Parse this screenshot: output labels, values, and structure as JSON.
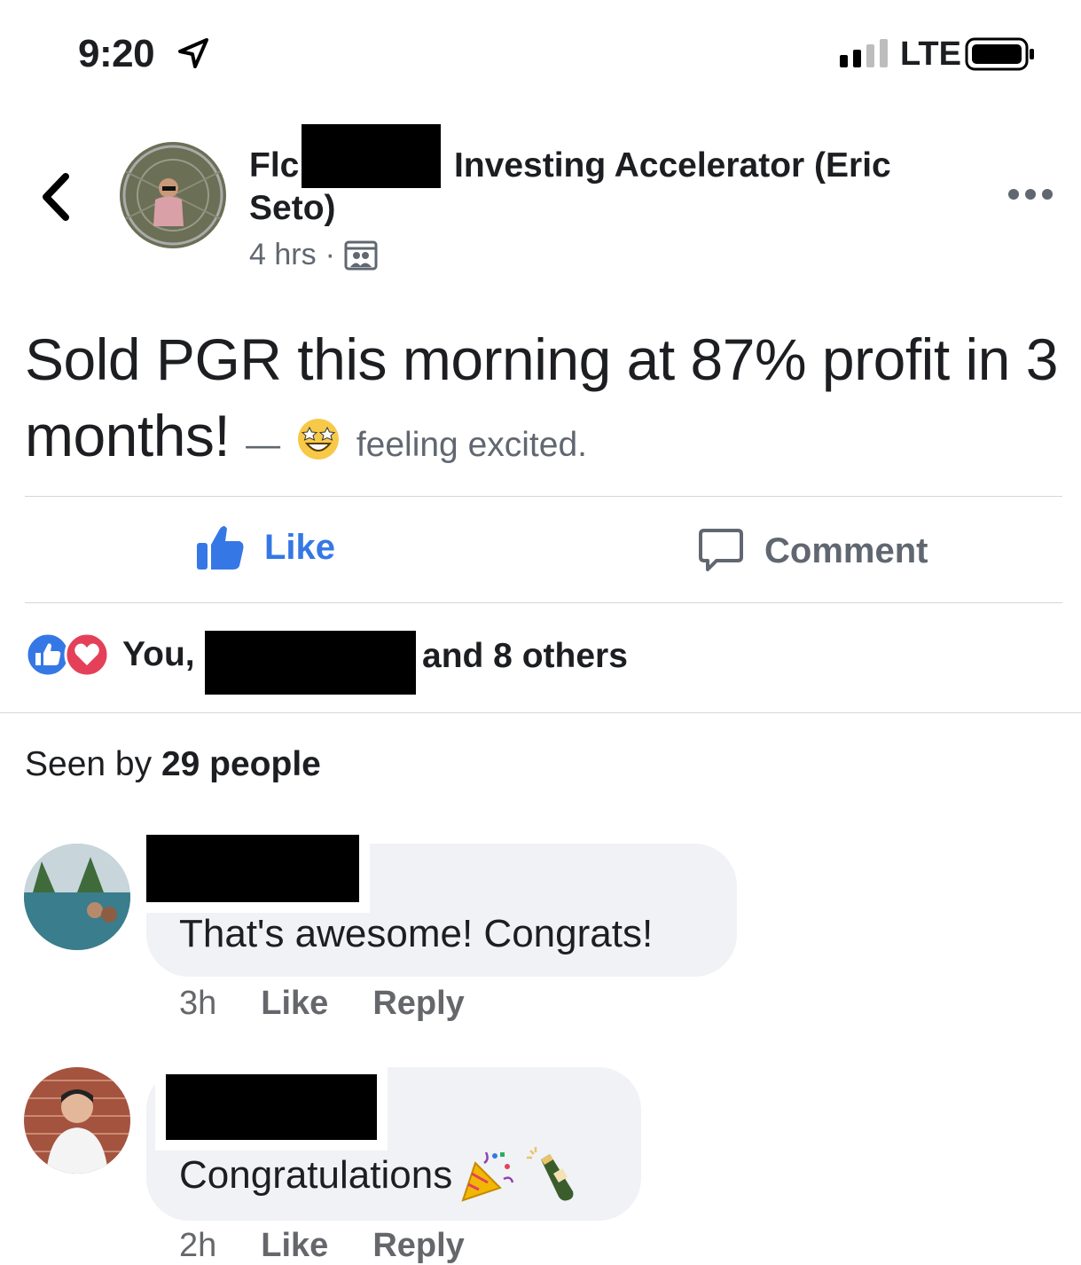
{
  "status_bar": {
    "time": "9:20",
    "network": "LTE"
  },
  "post": {
    "group_title_part1": "Flc",
    "group_title_part2": "Investing Accelerator (Eric",
    "group_title_line2": "Seto)",
    "time_ago": "4 hrs",
    "dot": "·",
    "text": "Sold PGR this morning at 87% profit in 3 months!",
    "feeling_dash": "—",
    "feeling_text": "feeling excited."
  },
  "actions": {
    "like_label": "Like",
    "comment_label": "Comment"
  },
  "reactions": {
    "you_label": "You,",
    "others_label": "and 8 others"
  },
  "seen": {
    "prefix": "Seen by",
    "count": "29 people"
  },
  "comments": [
    {
      "text": "That's awesome! Congrats!",
      "time": "3h",
      "like": "Like",
      "reply": "Reply"
    },
    {
      "text": "Congratulations",
      "time": "2h",
      "like": "Like",
      "reply": "Reply"
    }
  ],
  "colors": {
    "like_blue": "#3578e5",
    "love_red": "#e4405a",
    "bubble_gray": "#f0f2f5",
    "secondary_text": "#606770"
  },
  "icons": [
    "location-arrow-icon",
    "signal-icon",
    "battery-icon",
    "back-chevron-icon",
    "group-photo-icon",
    "more-dots-icon",
    "thumbs-up-icon",
    "comment-icon",
    "like-reaction-icon",
    "love-reaction-icon",
    "star-struck-emoji-icon",
    "party-popper-icon",
    "champagne-icon"
  ]
}
